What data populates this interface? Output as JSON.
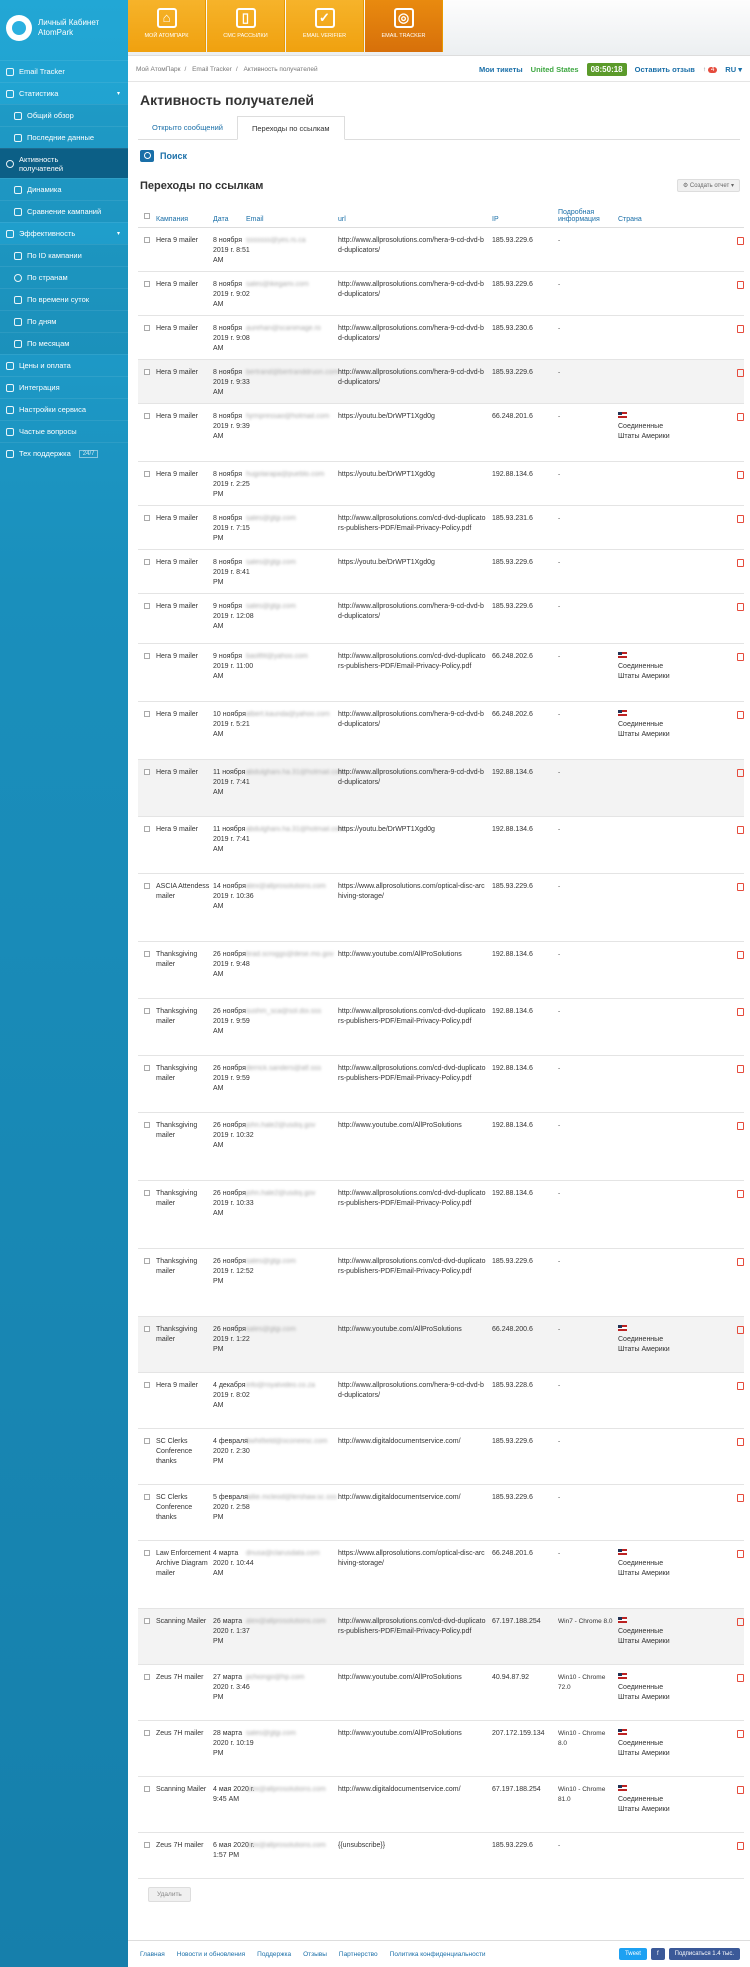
{
  "brand": {
    "line1": "Личный Кабинет",
    "line2": "AtomPark"
  },
  "sidebar": [
    {
      "label": "Email Tracker",
      "type": "top",
      "icon": "grid-icon"
    },
    {
      "label": "Статистика",
      "type": "top",
      "icon": "chart-icon",
      "caret": "▾"
    },
    {
      "label": "Общий обзор",
      "type": "sub",
      "icon": "square-icon"
    },
    {
      "label": "Последние данные",
      "type": "sub",
      "icon": "square-icon"
    },
    {
      "label": "Активность",
      "label2": "получателей",
      "type": "active",
      "icon": "circle-icon"
    },
    {
      "label": "Динамика",
      "type": "sub",
      "icon": "trend-icon"
    },
    {
      "label": "Сравнение кампаний",
      "type": "sub",
      "icon": "compare-icon"
    },
    {
      "label": "Эффективность",
      "type": "top",
      "icon": "gear-icon",
      "caret": "▾"
    },
    {
      "label": "По ID кампании",
      "type": "sub",
      "icon": "square-icon"
    },
    {
      "label": "По странам",
      "type": "sub",
      "icon": "circle-icon"
    },
    {
      "label": "По времени суток",
      "type": "sub",
      "icon": "clock-icon"
    },
    {
      "label": "По дням",
      "type": "sub",
      "icon": "square-icon"
    },
    {
      "label": "По месяцам",
      "type": "sub",
      "icon": "square-icon"
    },
    {
      "label": "Цены и оплата",
      "type": "top",
      "icon": "wallet-icon"
    },
    {
      "label": "Интеграция",
      "type": "top",
      "icon": "link-icon"
    },
    {
      "label": "Настройки сервиса",
      "type": "top",
      "icon": "settings-icon"
    },
    {
      "label": "Частые вопросы",
      "type": "top",
      "icon": "question-icon"
    },
    {
      "label": "Тех поддержка",
      "type": "top",
      "icon": "support-icon",
      "badge": "24/7"
    }
  ],
  "tiles": [
    {
      "label": "Мой АтомПарк",
      "glyph": "⌂",
      "icon": "home-icon"
    },
    {
      "label": "СМС рассылки",
      "glyph": "▯",
      "icon": "phone-icon"
    },
    {
      "label": "Email verifier",
      "glyph": "✓",
      "icon": "check-icon"
    },
    {
      "label": "Email tracker",
      "glyph": "◎",
      "icon": "tracker-icon"
    }
  ],
  "breadcrumb": [
    "Мой АтомПарк",
    "Email Tracker",
    "Активность получателей"
  ],
  "topright": {
    "tickets": "Мои тикеты",
    "country": "United States",
    "clock": "08:50:18",
    "feedback": "Оставить отзыв",
    "count": "4",
    "lang": "RU"
  },
  "page": {
    "title": "Активность получателей",
    "tab1": "Открыто сообщений",
    "tab2": "Переходы по ссылкам",
    "search": "Поиск",
    "section": "Переходы по ссылкам",
    "create": "Создать отчет",
    "delete": "Удалить"
  },
  "columns": {
    "campaign": "Кампания",
    "date": "Дата",
    "email": "Email",
    "url": "url",
    "ip": "IP",
    "info": "Подробная информация",
    "country": "Страна"
  },
  "rows": [
    {
      "h": 44,
      "c": "Hera 9 mailer",
      "d": "8 ноября 2019 г. 8:51 AM",
      "e": "sssssss@yes.rs.ca",
      "u": "http://www.allprosolutions.com/hera-9-cd-dvd-bd-duplicators/",
      "ip": "185.93.229.6",
      "i": "-",
      "co": ""
    },
    {
      "h": 44,
      "c": "Hera 9 mailer",
      "d": "8 ноября 2019 г. 9:02 AM",
      "e": "sales@ikegami.com",
      "u": "http://www.allprosolutions.com/hera-9-cd-dvd-bd-duplicators/",
      "ip": "185.93.229.6",
      "i": "-",
      "co": ""
    },
    {
      "h": 44,
      "c": "Hera 9 mailer",
      "d": "8 ноября 2019 г. 9:08 AM",
      "e": "aurehan@scanimage.ro",
      "u": "http://www.allprosolutions.com/hera-9-cd-dvd-bd-duplicators/",
      "ip": "185.93.230.6",
      "i": "-",
      "co": ""
    },
    {
      "h": 44,
      "c": "Hera 9 mailer",
      "d": "8 ноября 2019 г. 9:33 AM",
      "e": "bertrand@bertranddruon.com",
      "u": "http://www.allprosolutions.com/hera-9-cd-dvd-bd-duplicators/",
      "ip": "185.93.229.6",
      "i": "-",
      "co": ""
    },
    {
      "h": 58,
      "c": "Hera 9 mailer",
      "d": "8 ноября 2019 г. 9:39 AM",
      "e": "hjrmpressao@hotmail.com",
      "u": "https://youtu.be/DrWPT1Xgd0g",
      "ip": "66.248.201.6",
      "i": "-",
      "co": "Соединенные Штаты Америки"
    },
    {
      "h": 44,
      "c": "Hera 9 mailer",
      "d": "8 ноября 2019 г. 2:25 PM",
      "e": "hugolarapa@pueblo.com",
      "u": "https://youtu.be/DrWPT1Xgd0g",
      "ip": "192.88.134.6",
      "i": "-",
      "co": ""
    },
    {
      "h": 44,
      "c": "Hera 9 mailer",
      "d": "8 ноября 2019 г. 7:15 PM",
      "e": "sales@gtgi.com",
      "u": "http://www.allprosolutions.com/cd-dvd-duplicators-publishers-PDF/Email-Privacy-Policy.pdf",
      "ip": "185.93.231.6",
      "i": "-",
      "co": ""
    },
    {
      "h": 44,
      "c": "Hera 9 mailer",
      "d": "8 ноября 2019 г. 8:41 PM",
      "e": "sales@gtgi.com",
      "u": "https://youtu.be/DrWPT1Xgd0g",
      "ip": "185.93.229.6",
      "i": "-",
      "co": ""
    },
    {
      "h": 50,
      "c": "Hera 9 mailer",
      "d": "9 ноября 2019 г. 12:08 AM",
      "e": "sales@gtgi.com",
      "u": "http://www.allprosolutions.com/hera-9-cd-dvd-bd-duplicators/",
      "ip": "185.93.229.6",
      "i": "-",
      "co": ""
    },
    {
      "h": 58,
      "c": "Hera 9 mailer",
      "d": "9 ноября 2019 г. 11:00 AM",
      "e": "baoltfit@yahoo.com",
      "u": "http://www.allprosolutions.com/cd-dvd-duplicators-publishers-PDF/Email-Privacy-Policy.pdf",
      "ip": "66.248.202.6",
      "i": "-",
      "co": "Соединенные Штаты Америки"
    },
    {
      "h": 58,
      "c": "Hera 9 mailer",
      "d": "10 ноября 2019 г. 5:21 AM",
      "e": "albert.kaunda@yahoo.com",
      "u": "http://www.allprosolutions.com/hera-9-cd-dvd-bd-duplicators/",
      "ip": "66.248.202.6",
      "i": "-",
      "co": "Соединенные Штаты Америки"
    },
    {
      "h": 57,
      "c": "Hera 9 mailer",
      "d": "11 ноября 2019 г. 7:41 AM",
      "e": "abdulghani.ha.31@hotmail.com",
      "u": "http://www.allprosolutions.com/hera-9-cd-dvd-bd-duplicators/",
      "ip": "192.88.134.6",
      "i": "-",
      "co": ""
    },
    {
      "h": 57,
      "c": "Hera 9 mailer",
      "d": "11 ноября 2019 г. 7:41 AM",
      "e": "abdulghani.ha.31@hotmail.com",
      "u": "https://youtu.be/DrWPT1Xgd0g",
      "ip": "192.88.134.6",
      "i": "-",
      "co": ""
    },
    {
      "h": 68,
      "c": "ASCIA Attendess mailer",
      "d": "14 ноября 2019 г. 10:36 AM",
      "e": "alex@allprosolutions.com",
      "u": "https://www.allprosolutions.com/optical-disc-archiving-storage/",
      "ip": "185.93.229.6",
      "i": "-",
      "co": ""
    },
    {
      "h": 57,
      "c": "Thanksgiving mailer",
      "d": "26 ноября 2019 г. 9:48 AM",
      "e": "brad.scroggs@dese.mo.gov",
      "u": "http://www.youtube.com/AllProSolutions",
      "ip": "192.88.134.6",
      "i": "-",
      "co": ""
    },
    {
      "h": 57,
      "c": "Thanksgiving mailer",
      "d": "26 ноября 2019 г. 9:59 AM",
      "e": "sushm_sca@sol.doi.sss",
      "u": "http://www.allprosolutions.com/cd-dvd-duplicators-publishers-PDF/Email-Privacy-Policy.pdf",
      "ip": "192.88.134.6",
      "i": "-",
      "co": ""
    },
    {
      "h": 57,
      "c": "Thanksgiving mailer",
      "d": "26 ноября 2019 г. 9:59 AM",
      "e": "derrick.sanders@atf.sss",
      "u": "http://www.allprosolutions.com/cd-dvd-duplicators-publishers-PDF/Email-Privacy-Policy.pdf",
      "ip": "192.88.134.6",
      "i": "-",
      "co": ""
    },
    {
      "h": 68,
      "c": "Thanksgiving mailer",
      "d": "26 ноября 2019 г. 10:32 AM",
      "e": "john.hale2@usdoj.gov",
      "u": "http://www.youtube.com/AllProSolutions",
      "ip": "192.88.134.6",
      "i": "-",
      "co": ""
    },
    {
      "h": 68,
      "c": "Thanksgiving mailer",
      "d": "26 ноября 2019 г. 10:33 AM",
      "e": "john.hale2@usdoj.gov",
      "u": "http://www.allprosolutions.com/cd-dvd-duplicators-publishers-PDF/Email-Privacy-Policy.pdf",
      "ip": "192.88.134.6",
      "i": "-",
      "co": ""
    },
    {
      "h": 68,
      "c": "Thanksgiving mailer",
      "d": "26 ноября 2019 г. 12:52 PM",
      "e": "sales@gtgi.com",
      "u": "http://www.allprosolutions.com/cd-dvd-duplicators-publishers-PDF/Email-Privacy-Policy.pdf",
      "ip": "185.93.229.6",
      "i": "-",
      "co": ""
    },
    {
      "h": 56,
      "c": "Thanksgiving mailer",
      "d": "26 ноября 2019 г. 1:22 PM",
      "e": "sales@gtgi.com",
      "u": "http://www.youtube.com/AllProSolutions",
      "ip": "66.248.200.6",
      "i": "-",
      "co": "Соединенные Штаты Америки"
    },
    {
      "h": 56,
      "c": "Hera 9 mailer",
      "d": "4 декабря 2019 г. 8:02 AM",
      "e": "info@royalvideo.co.za",
      "u": "http://www.allprosolutions.com/hera-9-cd-dvd-bd-duplicators/",
      "ip": "185.93.228.6",
      "i": "-",
      "co": ""
    },
    {
      "h": 56,
      "c": "SC Clerks Conference thanks",
      "d": "4 февраля 2020 г. 2:30 PM",
      "e": "bwhitfield@oconeesc.com",
      "u": "http://www.digitaldocumentservice.com/",
      "ip": "185.93.229.6",
      "i": "-",
      "co": ""
    },
    {
      "h": 56,
      "c": "SC Clerks Conference thanks",
      "d": "5 февраля 2020 г. 2:58 PM",
      "e": "lallie.mcleod@lershaw.sc.sss",
      "u": "http://www.digitaldocumentservice.com/",
      "ip": "185.93.229.6",
      "i": "-",
      "co": ""
    },
    {
      "h": 68,
      "c": "Law Enforcement Archive Diagram mailer",
      "d": "4 марта 2020 г. 10:44 AM",
      "e": "dnusa@clarusdata.com",
      "u": "https://www.allprosolutions.com/optical-disc-archiving-storage/",
      "ip": "66.248.201.6",
      "i": "-",
      "co": "Соединенные Штаты Америки"
    },
    {
      "h": 56,
      "c": "Scanning Mailer",
      "d": "26 марта 2020 г. 1:37 PM",
      "e": "alex@allprosolutions.com",
      "u": "http://www.allprosolutions.com/cd-dvd-duplicators-publishers-PDF/Email-Privacy-Policy.pdf",
      "ip": "67.197.188.254",
      "i": "Win7 - Chrome 8.0",
      "co": "Соединенные Штаты Америки"
    },
    {
      "h": 56,
      "c": "Zeus 7H mailer",
      "d": "27 марта 2020 г. 3:46 PM",
      "e": "pchiongo@hp.com",
      "u": "http://www.youtube.com/AllProSolutions",
      "ip": "40.94.87.92",
      "i": "Win10 - Chrome 72.0",
      "co": "Соединенные Штаты Америки"
    },
    {
      "h": 56,
      "c": "Zeus 7H mailer",
      "d": "28 марта 2020 г. 10:19 PM",
      "e": "sales@gtgi.com",
      "u": "http://www.youtube.com/AllProSolutions",
      "ip": "207.172.159.134",
      "i": "Win10 - Chrome 8.0",
      "co": "Соединенные Штаты Америки"
    },
    {
      "h": 56,
      "c": "Scanning Mailer",
      "d": "4 мая 2020 г. 9:45 AM",
      "e": "alex@allprosolutions.com",
      "u": "http://www.digitaldocumentservice.com/",
      "ip": "67.197.188.254",
      "i": "Win10 - Chrome 81.0",
      "co": "Соединенные Штаты Америки"
    },
    {
      "h": 46,
      "c": "Zeus 7H mailer",
      "d": "6 мая 2020 г. 1:57 PM",
      "e": "alex@allprosolutions.com",
      "u": "{{unsubscribe}}",
      "ip": "185.93.229.6",
      "i": "-",
      "co": ""
    }
  ],
  "footer": [
    "Главная",
    "Новости и обновления",
    "Поддержка",
    "Отзывы",
    "Партнерство",
    "Политика конфиденциальности"
  ],
  "social": {
    "tweet": "Tweet",
    "fb": "f",
    "subscribe": "Подписаться 1.4 тыс."
  }
}
